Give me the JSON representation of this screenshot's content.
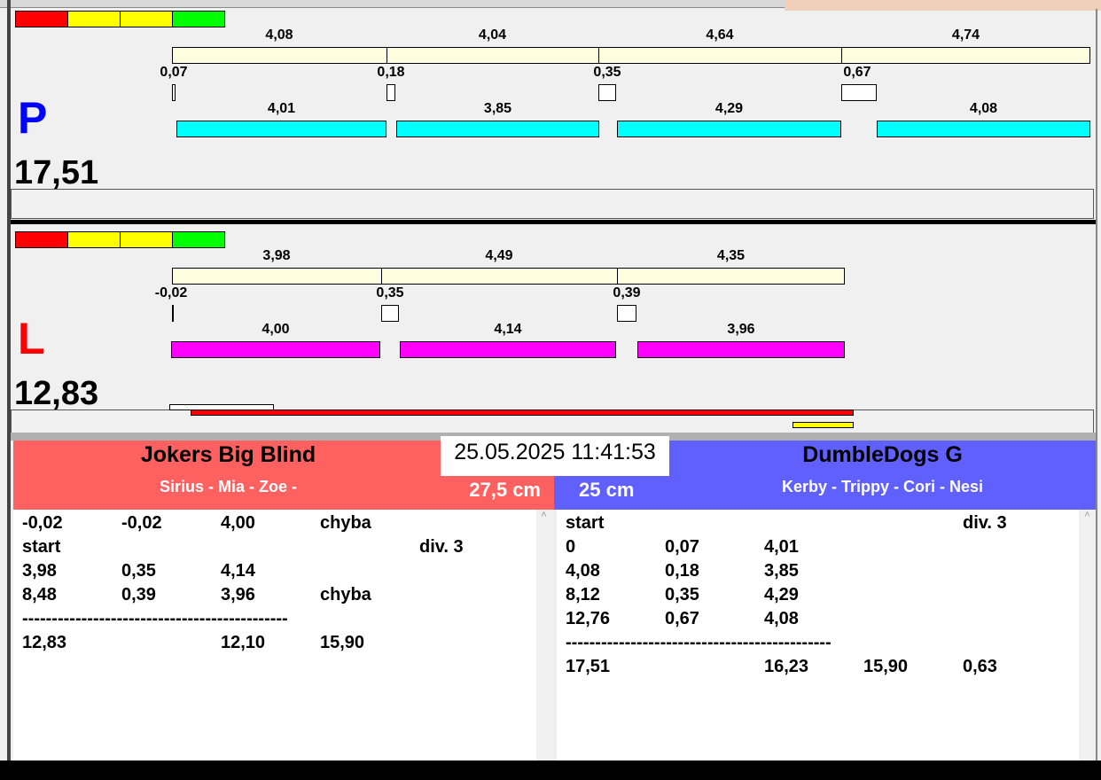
{
  "colors": {
    "red": "#ff0000",
    "yellow": "#ffff00",
    "green": "#00ff00",
    "cream": "#ffffe0",
    "cyan": "#00ffff",
    "magenta": "#ff00ff",
    "left_team": "#ff6060",
    "right_team": "#6060ff"
  },
  "p": {
    "letter": "P",
    "total": "17,51",
    "runs": [
      "4,08",
      "4,04",
      "4,64",
      "4,74"
    ],
    "reactions": [
      "0,07",
      "0,18",
      "0,35",
      "0,67"
    ],
    "times": [
      "4,01",
      "3,85",
      "4,29",
      "4,08"
    ]
  },
  "l": {
    "letter": "L",
    "total": "12,83",
    "runs": [
      "3,98",
      "4,49",
      "4,35"
    ],
    "reactions": [
      "-0,02",
      "0,35",
      "0,39"
    ],
    "times": [
      "4,00",
      "4,14",
      "3,96"
    ]
  },
  "datetime": "25.05.2025 11:41:53",
  "left_team": {
    "name": "Jokers Big Blind",
    "dogs": "Sirius - Mia - Zoe -",
    "height": "27,5 cm",
    "rows": [
      [
        "-0,02",
        "-0,02",
        "4,00",
        "chyba",
        ""
      ],
      [
        "start",
        "",
        "",
        "",
        "div.  3"
      ],
      [
        "3,98",
        "0,35",
        "4,14",
        "",
        ""
      ],
      [
        "8,48",
        "0,39",
        "3,96",
        "chyba",
        ""
      ],
      [
        "---------------------------------------------",
        "",
        "",
        "",
        ""
      ],
      [
        "12,83",
        "",
        "12,10",
        "15,90",
        ""
      ]
    ]
  },
  "right_team": {
    "name": "DumbleDogs G",
    "dogs": "Kerby - Trippy - Cori - Nesi",
    "height": "25 cm",
    "rows": [
      [
        "start",
        "",
        "",
        "",
        "div.  3"
      ],
      [
        "0",
        "0,07",
        "4,01",
        "",
        ""
      ],
      [
        "4,08",
        "0,18",
        "3,85",
        "",
        ""
      ],
      [
        "8,12",
        "0,35",
        "4,29",
        "",
        ""
      ],
      [
        "12,76",
        "0,67",
        "4,08",
        "",
        ""
      ],
      [
        "---------------------------------------------",
        "",
        "",
        "",
        ""
      ],
      [
        "17,51",
        "",
        "16,23",
        "15,90",
        "0,63"
      ]
    ]
  }
}
